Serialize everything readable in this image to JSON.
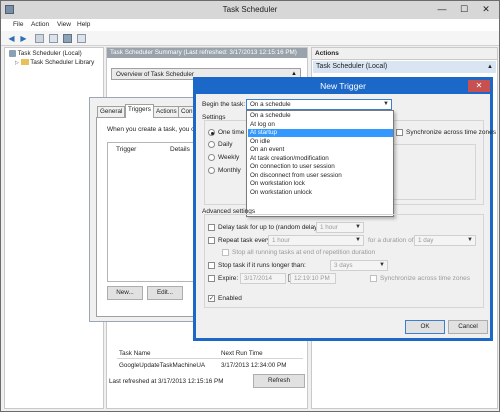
{
  "window": {
    "title": "Task Scheduler"
  },
  "menu": [
    "File",
    "Action",
    "View",
    "Help"
  ],
  "tree": {
    "root": "Task Scheduler (Local)",
    "child": "Task Scheduler Library"
  },
  "center": {
    "header": "Task Scheduler Summary (Last refreshed: 3/17/2013 12:15:16 PM)",
    "overview": "Overview of Task Scheduler",
    "table_headers": [
      "Task Name",
      "Next Run Time"
    ],
    "table_rows": [
      [
        "GoogleUpdateTaskMachineUA",
        "3/17/2013 12:34:00 PM"
      ]
    ],
    "last_refreshed": "Last refreshed at 3/17/2013 12:15:16 PM",
    "refresh": "Refresh"
  },
  "actions": {
    "header": "Actions",
    "sub": "Task Scheduler (Local)"
  },
  "props": {
    "tabs": [
      "General",
      "Triggers",
      "Actions",
      "Con"
    ],
    "text": "When you create a task, you can",
    "col_trigger": "Trigger",
    "col_details": "Details",
    "btn_new": "New...",
    "btn_edit": "Edit..."
  },
  "new_trigger": {
    "title": "New Trigger",
    "close": "✕",
    "begin_label": "Begin the task:",
    "begin_value": "On a schedule",
    "settings_label": "Settings",
    "radios": [
      "One time",
      "Daily",
      "Weekly",
      "Monthly"
    ],
    "sync_label": "Synchronize across time zones",
    "dropdown": [
      "On a schedule",
      "At log on",
      "At startup",
      "On idle",
      "On an event",
      "At task creation/modification",
      "On connection to user session",
      "On disconnect from user session",
      "On workstation lock",
      "On workstation unlock"
    ],
    "dropdown_selected": 2,
    "advanced_label": "Advanced settings",
    "delay_label": "Delay task for up to (random delay):",
    "delay_value": "1 hour",
    "repeat_label": "Repeat task every:",
    "repeat_value": "1 hour",
    "duration_label": "for a duration of:",
    "duration_value": "1 day",
    "stop_all_label": "Stop all running tasks at end of repetition duration",
    "stop_longer_label": "Stop task if it runs longer than:",
    "stop_longer_value": "3 days",
    "expire_label": "Expire:",
    "expire_date": "3/17/2014",
    "expire_time": "12:19:10 PM",
    "expire_sync_label": "Synchronize across time zones",
    "enabled_label": "Enabled",
    "enabled_checked": "✓",
    "ok": "OK",
    "cancel": "Cancel"
  }
}
